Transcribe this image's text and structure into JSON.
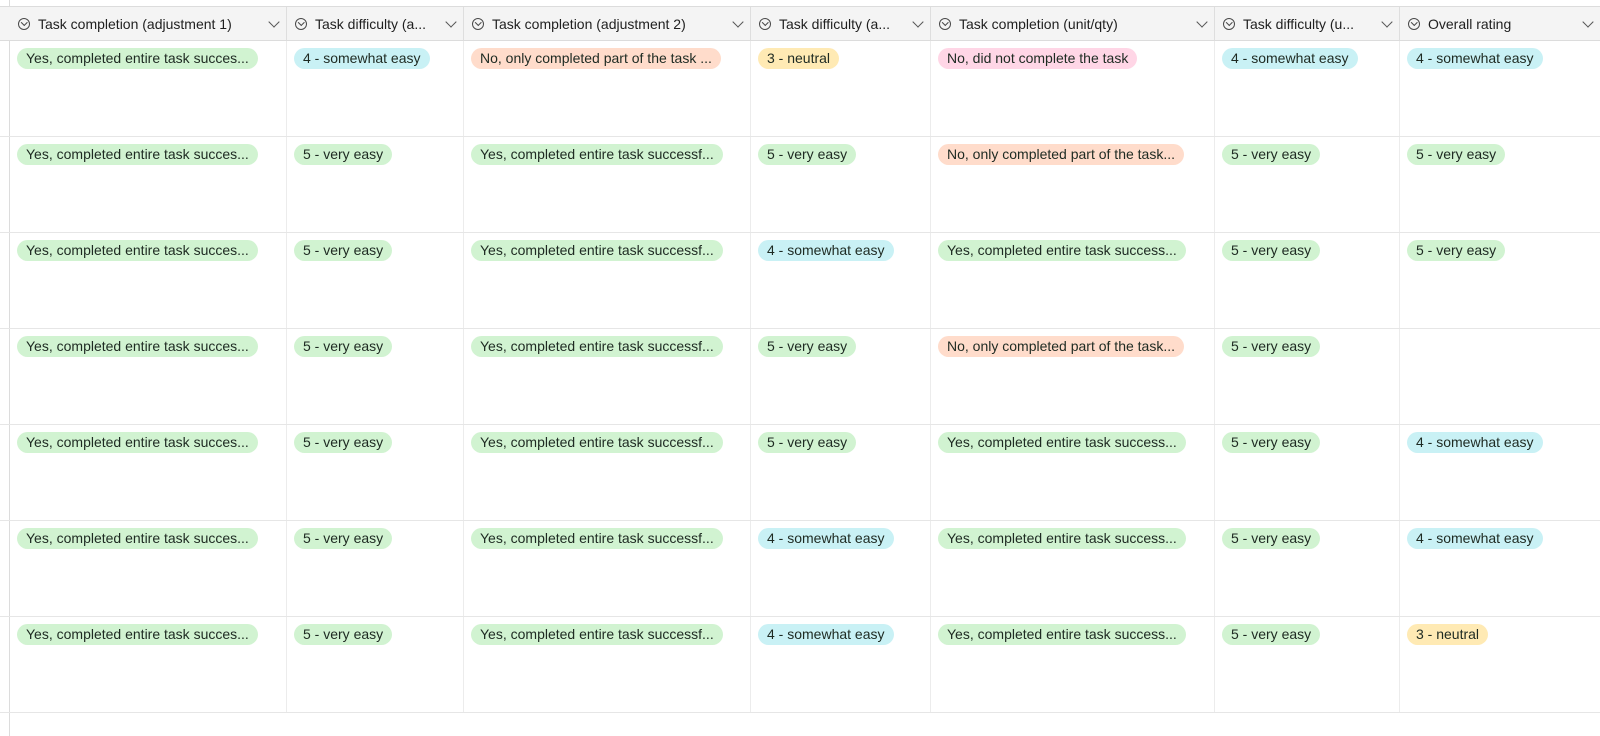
{
  "columns": [
    {
      "label": "Task completion (adjustment 1)"
    },
    {
      "label": "Task difficulty (a..."
    },
    {
      "label": "Task completion (adjustment 2)"
    },
    {
      "label": "Task difficulty (a..."
    },
    {
      "label": "Task completion (unit/qty)"
    },
    {
      "label": "Task difficulty (u..."
    },
    {
      "label": "Overall rating"
    }
  ],
  "colors": {
    "green": "#d1f3d1",
    "cyan": "#c9f1f5",
    "orange": "#ffdccb",
    "yellow": "#ffeab4",
    "pink": "#ffd6e6",
    "header_bg": "#f4f4f4"
  },
  "rows": [
    {
      "cells": [
        {
          "text": "Yes, completed entire task succes...",
          "color": "green"
        },
        {
          "text": "4 - somewhat easy",
          "color": "cyan"
        },
        {
          "text": "No, only completed part of the task ...",
          "color": "orange"
        },
        {
          "text": "3 - neutral",
          "color": "yellow"
        },
        {
          "text": "No, did not complete the task",
          "color": "pink"
        },
        {
          "text": "4 - somewhat easy",
          "color": "cyan"
        },
        {
          "text": "4 - somewhat easy",
          "color": "cyan"
        }
      ]
    },
    {
      "cells": [
        {
          "text": "Yes, completed entire task succes...",
          "color": "green"
        },
        {
          "text": "5 - very easy",
          "color": "green"
        },
        {
          "text": "Yes, completed entire task successf...",
          "color": "green"
        },
        {
          "text": "5 - very easy",
          "color": "green"
        },
        {
          "text": "No, only completed part of the task...",
          "color": "orange"
        },
        {
          "text": "5 - very easy",
          "color": "green"
        },
        {
          "text": "5 - very easy",
          "color": "green"
        }
      ]
    },
    {
      "cells": [
        {
          "text": "Yes, completed entire task succes...",
          "color": "green"
        },
        {
          "text": "5 - very easy",
          "color": "green"
        },
        {
          "text": "Yes, completed entire task successf...",
          "color": "green"
        },
        {
          "text": "4 - somewhat easy",
          "color": "cyan"
        },
        {
          "text": "Yes, completed entire task success...",
          "color": "green"
        },
        {
          "text": "5 - very easy",
          "color": "green"
        },
        {
          "text": "5 - very easy",
          "color": "green"
        }
      ]
    },
    {
      "cells": [
        {
          "text": "Yes, completed entire task succes...",
          "color": "green"
        },
        {
          "text": "5 - very easy",
          "color": "green"
        },
        {
          "text": "Yes, completed entire task successf...",
          "color": "green"
        },
        {
          "text": "5 - very easy",
          "color": "green"
        },
        {
          "text": "No, only completed part of the task...",
          "color": "orange"
        },
        {
          "text": "5 - very easy",
          "color": "green"
        },
        {
          "text": "",
          "color": ""
        }
      ]
    },
    {
      "cells": [
        {
          "text": "Yes, completed entire task succes...",
          "color": "green"
        },
        {
          "text": "5 - very easy",
          "color": "green"
        },
        {
          "text": "Yes, completed entire task successf...",
          "color": "green"
        },
        {
          "text": "5 - very easy",
          "color": "green"
        },
        {
          "text": "Yes, completed entire task success...",
          "color": "green"
        },
        {
          "text": "5 - very easy",
          "color": "green"
        },
        {
          "text": "4 - somewhat easy",
          "color": "cyan"
        }
      ]
    },
    {
      "cells": [
        {
          "text": "Yes, completed entire task succes...",
          "color": "green"
        },
        {
          "text": "5 - very easy",
          "color": "green"
        },
        {
          "text": "Yes, completed entire task successf...",
          "color": "green"
        },
        {
          "text": "4 - somewhat easy",
          "color": "cyan"
        },
        {
          "text": "Yes, completed entire task success...",
          "color": "green"
        },
        {
          "text": "5 - very easy",
          "color": "green"
        },
        {
          "text": "4 - somewhat easy",
          "color": "cyan"
        }
      ]
    },
    {
      "cells": [
        {
          "text": "Yes, completed entire task succes...",
          "color": "green"
        },
        {
          "text": "5 - very easy",
          "color": "green"
        },
        {
          "text": "Yes, completed entire task successf...",
          "color": "green"
        },
        {
          "text": "4 - somewhat easy",
          "color": "cyan"
        },
        {
          "text": "Yes, completed entire task success...",
          "color": "green"
        },
        {
          "text": "5 - very easy",
          "color": "green"
        },
        {
          "text": "3 - neutral",
          "color": "yellow"
        }
      ]
    }
  ]
}
